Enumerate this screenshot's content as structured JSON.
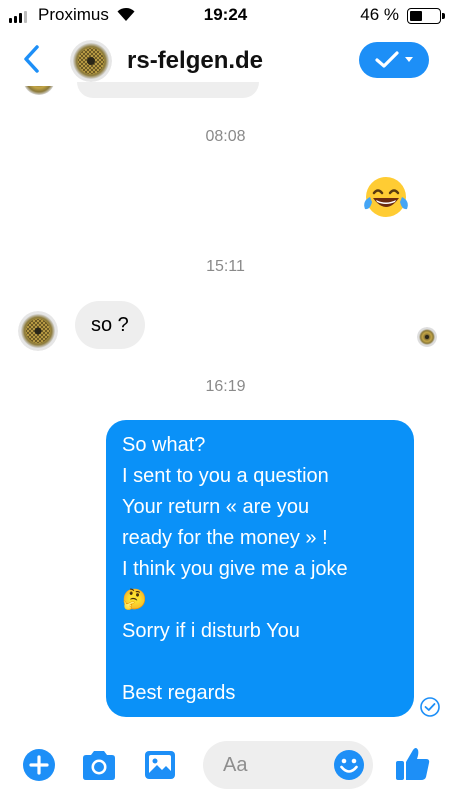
{
  "status_bar": {
    "carrier": "Proximus",
    "time": "19:24",
    "battery_percent": "46 %",
    "battery_level": 0.46
  },
  "header": {
    "title": "rs-felgen.de",
    "back_icon": "chevron-left-icon",
    "action_icon": "check-dropdown-icon"
  },
  "messages": {
    "timestamp_1": "08:08",
    "emoji_1": "😂",
    "timestamp_2": "15:11",
    "incoming_text": "so ?",
    "timestamp_3": "16:19",
    "outgoing_lines": [
      "So what?",
      "I sent to you a question",
      "Your return « are you",
      "ready for the money » !",
      "I think you give me a joke",
      "🤔",
      "Sorry if i disturb You",
      "",
      "Best regards"
    ]
  },
  "composer": {
    "placeholder": "Aa",
    "icons": [
      "plus-icon",
      "camera-icon",
      "image-icon",
      "emoji-icon",
      "thumbs-up-icon"
    ]
  },
  "colors": {
    "accent": "#0a91f8",
    "incoming_bubble": "#eeeeee",
    "timestamp": "#8a8a8a"
  }
}
